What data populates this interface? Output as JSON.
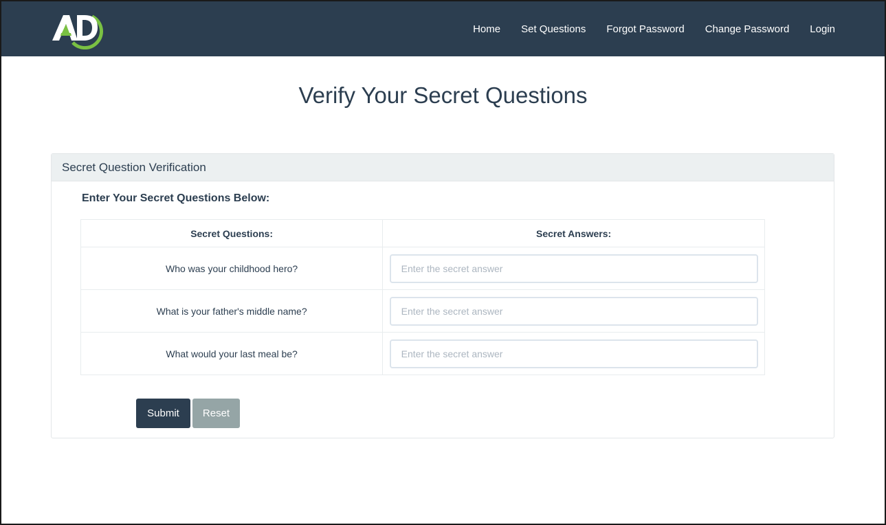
{
  "brand": {
    "logo_text": "AD",
    "colors": {
      "navy": "#2c3e50",
      "green": "#7ac143"
    }
  },
  "nav": {
    "items": [
      {
        "label": "Home"
      },
      {
        "label": "Set Questions"
      },
      {
        "label": "Forgot Password"
      },
      {
        "label": "Change Password"
      },
      {
        "label": "Login"
      }
    ]
  },
  "page": {
    "title": "Verify Your Secret Questions"
  },
  "panel": {
    "heading": "Secret Question Verification",
    "subtitle": "Enter Your Secret Questions Below:",
    "table": {
      "headers": {
        "question": "Secret Questions:",
        "answer": "Secret Answers:"
      },
      "rows": [
        {
          "question": "Who was your childhood hero?",
          "placeholder": "Enter the secret answer",
          "value": ""
        },
        {
          "question": "What is your father's middle name?",
          "placeholder": "Enter the secret answer",
          "value": ""
        },
        {
          "question": "What would your last meal be?",
          "placeholder": "Enter the secret answer",
          "value": ""
        }
      ]
    },
    "buttons": {
      "submit": "Submit",
      "reset": "Reset"
    }
  }
}
